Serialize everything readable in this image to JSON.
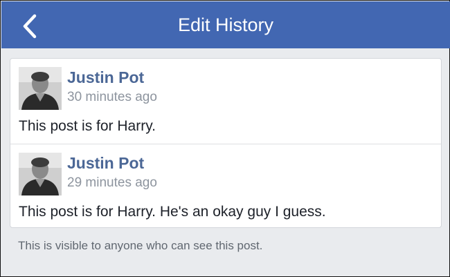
{
  "header": {
    "title": "Edit History",
    "back_icon": "chevron-left-icon"
  },
  "entries": [
    {
      "author": "Justin Pot",
      "time": "30 minutes ago",
      "text": "This post is for Harry."
    },
    {
      "author": "Justin Pot",
      "time": "29 minutes ago",
      "text": "This post is for Harry. He's an okay guy I guess."
    }
  ],
  "footer": {
    "note": "This is visible to anyone who can see this post."
  },
  "colors": {
    "navbar": "#4267b2",
    "author_link": "#4b6796",
    "timestamp": "#8d949e",
    "background": "#e9ebee"
  }
}
